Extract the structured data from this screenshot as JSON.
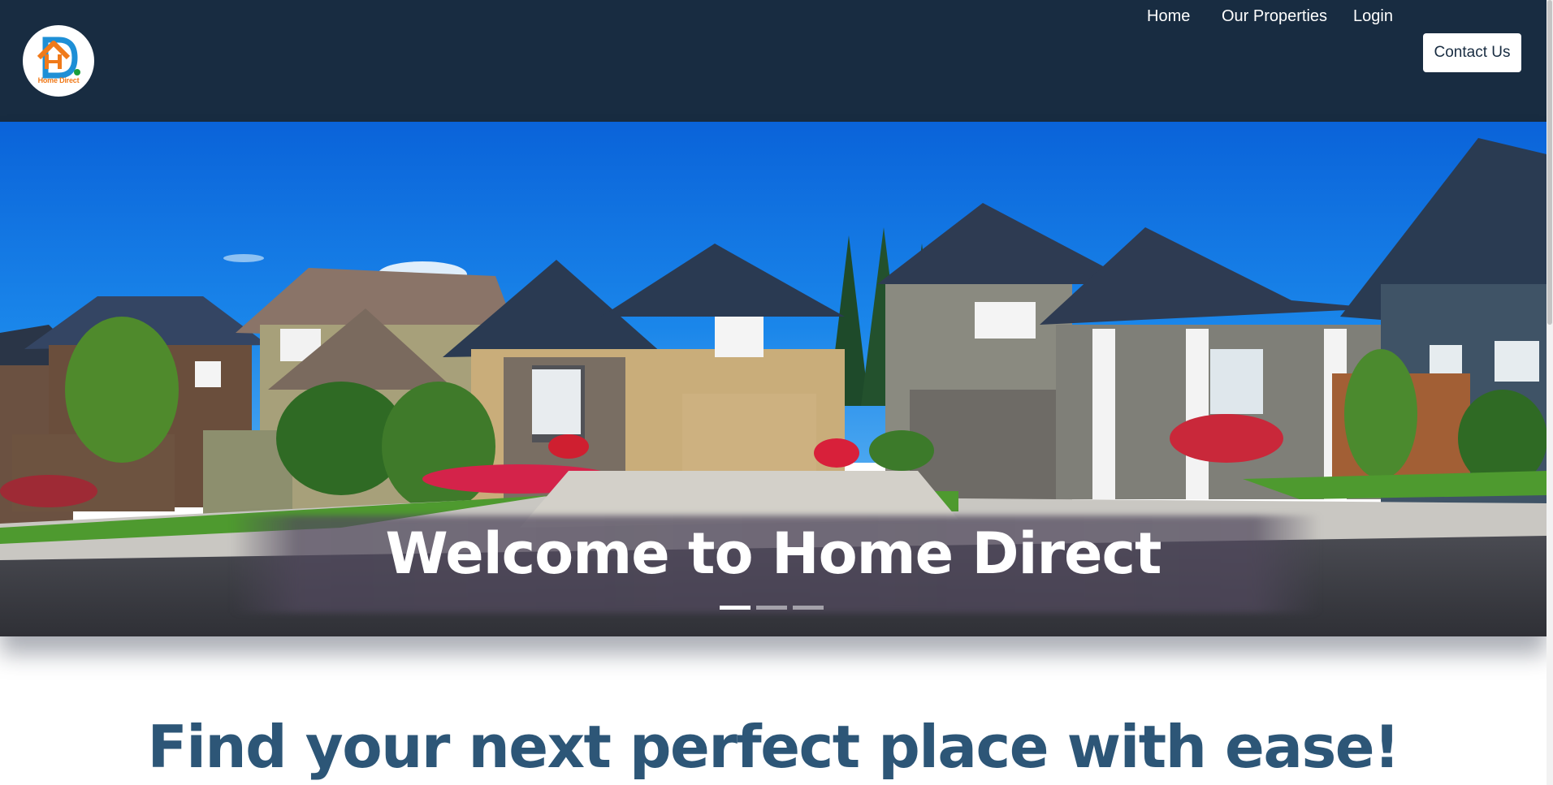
{
  "brand": {
    "logo_icon": "home-direct-logo-icon",
    "logo_text": "Home Direct",
    "colors": {
      "navbar": "#182c41",
      "logo_orange": "#f07a1a",
      "logo_blue": "#1e8fd6",
      "logo_green": "#1a9e3a",
      "tagline": "#2d5677"
    }
  },
  "nav": {
    "home": "Home",
    "properties": "Our Properties",
    "login": "Login",
    "contact": "Contact Us"
  },
  "hero": {
    "title": "Welcome to Home Direct",
    "slides_total": 3,
    "active_slide": 1,
    "image_icon": "suburban-houses-photo"
  },
  "tagline": "Find your next perfect place with ease!"
}
